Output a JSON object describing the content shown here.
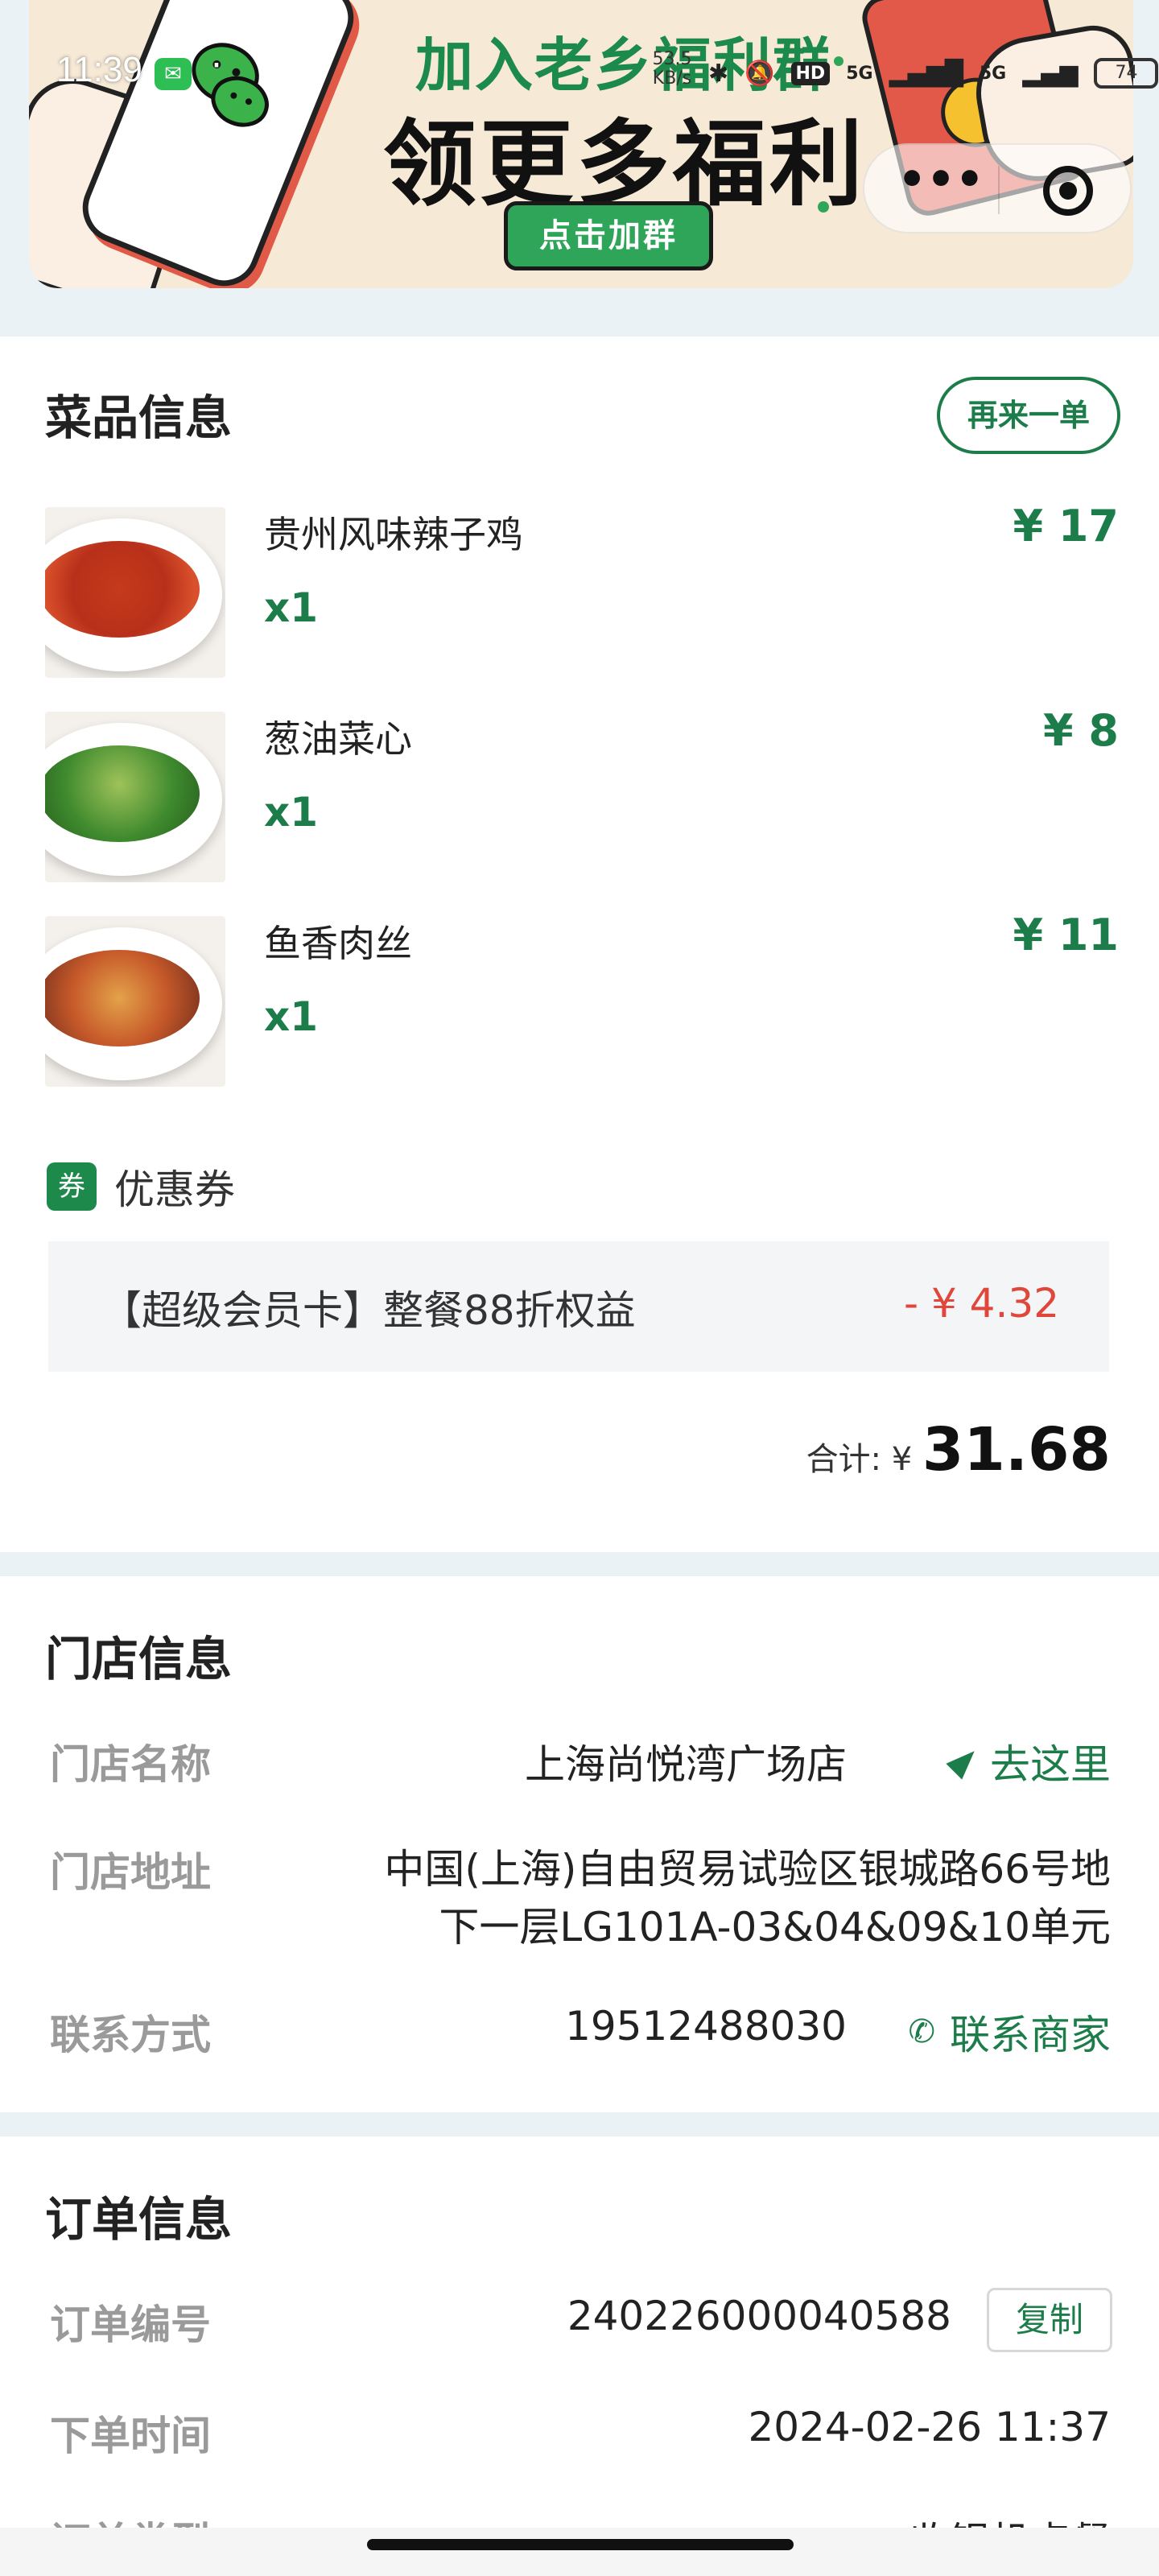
{
  "status_bar": {
    "time": "11:39",
    "network_speed": "53.5 KB/s",
    "network_badge": "HD",
    "signal_1": "5G",
    "signal_2": "5G",
    "battery": "74"
  },
  "banner": {
    "headline": "加入老乡福利群",
    "main_text": "领更多福利",
    "button_label": "点击加群",
    "colors": {
      "background": "#f6e9d6",
      "green": "#1b8a4b",
      "red": "#e2594a"
    }
  },
  "capsule": {
    "more_icon": "more-dots-icon",
    "close_icon": "target-circle-icon"
  },
  "dishes_section": {
    "title": "菜品信息",
    "reorder_label": "再来一单",
    "items": [
      {
        "name": "贵州风味辣子鸡",
        "qty": "x1",
        "price": "¥ 17"
      },
      {
        "name": "葱油菜心",
        "qty": "x1",
        "price": "¥ 8"
      },
      {
        "name": "鱼香肉丝",
        "qty": "x1",
        "price": "¥ 11"
      }
    ],
    "coupon": {
      "icon_text": "券",
      "label": "优惠券",
      "name": "【超级会员卡】整餐88折权益",
      "amount": "- ¥ 4.32"
    },
    "total": {
      "label": "合计: ¥ ",
      "value": "31.68"
    }
  },
  "store_section": {
    "title": "门店信息",
    "name_label": "门店名称",
    "name_value": "上海尚悦湾广场店",
    "navigate_label": "去这里",
    "address_label": "门店地址",
    "address_line1": "中国(上海)自由贸易试验区银城路66号地",
    "address_line2": "下一层LG101A-03&04&09&10单元",
    "contact_label": "联系方式",
    "contact_value": "19512488030",
    "contact_action": "联系商家"
  },
  "order_section": {
    "title": "订单信息",
    "number_label": "订单编号",
    "number_value": "240226000040588",
    "copy_label": "复制",
    "time_label": "下单时间",
    "time_value": "2024-02-26 11:37",
    "type_label": "订单类型",
    "type_value": "收银机点餐"
  },
  "theme": {
    "accent": "#1d7d4a",
    "discount": "#e0463a",
    "page_bg": "#eaf2f5"
  }
}
